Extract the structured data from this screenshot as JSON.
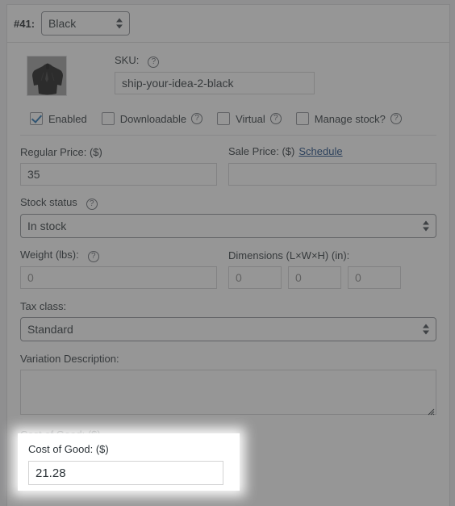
{
  "variation": {
    "number_label": "#41:",
    "attribute_select": {
      "value": "Black",
      "options": [
        "Black"
      ]
    }
  },
  "image": {
    "alt": "black-hoodie-thumbnail"
  },
  "sku": {
    "label": "SKU:",
    "help": "?",
    "value": "ship-your-idea-2-black",
    "placeholder": ""
  },
  "checkboxes": [
    {
      "label": "Enabled",
      "checked": true,
      "help": null
    },
    {
      "label": "Downloadable",
      "checked": false,
      "help": "?"
    },
    {
      "label": "Virtual",
      "checked": false,
      "help": "?"
    },
    {
      "label": "Manage stock?",
      "checked": false,
      "help": "?"
    }
  ],
  "regular_price": {
    "label": "Regular Price: ($)",
    "value": "35",
    "placeholder": ""
  },
  "sale_price": {
    "label": "Sale Price: ($)",
    "schedule_link": "Schedule",
    "value": "",
    "placeholder": ""
  },
  "stock_status": {
    "label": "Stock status",
    "help": "?",
    "value": "In stock",
    "options": [
      "In stock"
    ]
  },
  "weight": {
    "label": "Weight (lbs):",
    "help": "?",
    "value": "",
    "placeholder": "0"
  },
  "dimensions": {
    "label": "Dimensions (L×W×H) (in):",
    "length": {
      "value": "",
      "placeholder": "0"
    },
    "width": {
      "value": "",
      "placeholder": "0"
    },
    "height": {
      "value": "",
      "placeholder": "0"
    }
  },
  "tax_class": {
    "label": "Tax class:",
    "value": "Standard",
    "options": [
      "Standard"
    ]
  },
  "variation_description": {
    "label": "Variation Description:",
    "value": "",
    "placeholder": ""
  },
  "cost_of_good": {
    "label": "Cost of Good: ($)",
    "value": "21.28",
    "placeholder": ""
  },
  "colors": {
    "accent_blue": "#2271b1",
    "link_blue": "#16437e",
    "text": "#2c3338",
    "border": "#dcdcde",
    "overlay": "rgba(64,64,64,0.55)"
  }
}
